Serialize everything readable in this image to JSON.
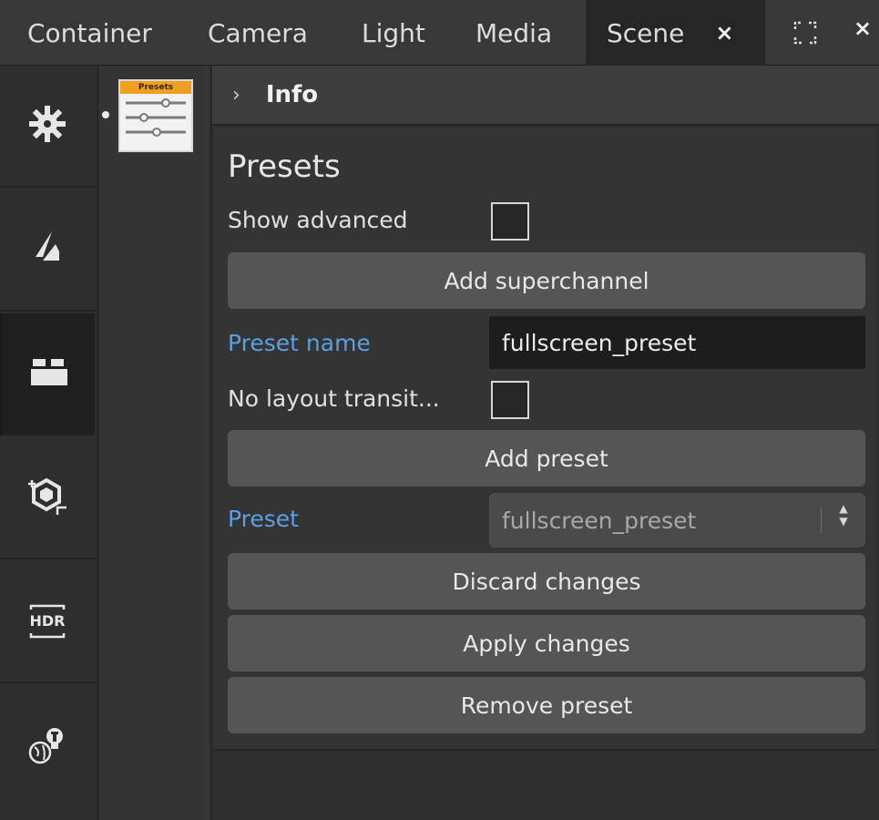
{
  "tabs": [
    {
      "label": "Container"
    },
    {
      "label": "Camera"
    },
    {
      "label": "Light"
    },
    {
      "label": "Media"
    },
    {
      "label": "Scene",
      "close": "×"
    }
  ],
  "window": {
    "close": "×"
  },
  "rail": {
    "icons": [
      "gear-icon",
      "layers-icon",
      "scene-icon",
      "3d-object-icon",
      "hdr-icon",
      "globe-light-icon"
    ],
    "hdr_text": "HDR"
  },
  "node": {
    "label": "Presets"
  },
  "info": {
    "chevron": "›",
    "title": "Info"
  },
  "presets": {
    "title": "Presets",
    "show_advanced_label": "Show advanced",
    "add_superchannel_label": "Add superchannel",
    "preset_name_label": "Preset name",
    "preset_name_value": "fullscreen_preset",
    "no_layout_label": "No layout transit...",
    "add_preset_label": "Add preset",
    "preset_label": "Preset",
    "preset_select_value": "fullscreen_preset",
    "discard_label": "Discard changes",
    "apply_label": "Apply changes",
    "remove_label": "Remove preset"
  },
  "colors": {
    "accent_blue": "#5aa0e0",
    "node_header": "#f0a020"
  }
}
